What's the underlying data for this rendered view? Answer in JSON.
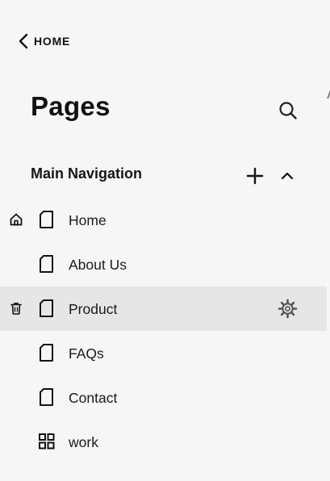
{
  "back": {
    "label": "HOME",
    "icon": "chevron-left-icon"
  },
  "header": {
    "title": "Pages",
    "search_icon": "search-icon"
  },
  "section": {
    "title": "Main Navigation",
    "add_icon": "plus-icon",
    "collapse_icon": "chevron-up-icon"
  },
  "items": [
    {
      "label": "Home",
      "icon": "page-icon",
      "left_icon": "home-icon",
      "active": false
    },
    {
      "label": "About Us",
      "icon": "page-icon",
      "active": false
    },
    {
      "label": "Product",
      "icon": "page-icon",
      "left_icon": "trash-icon",
      "right_icon": "gear-icon",
      "active": true
    },
    {
      "label": "FAQs",
      "icon": "page-icon",
      "active": false
    },
    {
      "label": "Contact",
      "icon": "page-icon",
      "active": false
    },
    {
      "label": "work",
      "icon": "grid-icon",
      "active": false
    }
  ],
  "colors": {
    "background": "#f6f6f6",
    "active_row": "#e6e6e6",
    "text": "#1a1a1a"
  }
}
